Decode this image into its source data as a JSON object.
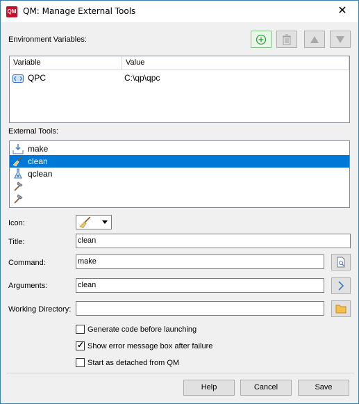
{
  "window": {
    "title": "QM: Manage External Tools",
    "close_glyph": "✕"
  },
  "env": {
    "label": "Environment Variables:",
    "columns": [
      "Variable",
      "Value"
    ],
    "rows": [
      {
        "variable": "QPC",
        "value": "C:\\qp\\qpc"
      }
    ]
  },
  "tools": {
    "label": "External Tools:",
    "items": [
      {
        "label": "make",
        "icon": "hammer-download-icon"
      },
      {
        "label": "clean",
        "icon": "broom-icon"
      },
      {
        "label": "qclean",
        "icon": "flask-icon"
      },
      {
        "label": "",
        "icon": "hammer-icon"
      },
      {
        "label": "",
        "icon": "hammer-icon"
      }
    ],
    "selected_index": 1
  },
  "form": {
    "icon_label": "Icon:",
    "title_label": "Title:",
    "title_value": "clean",
    "command_label": "Command:",
    "command_value": "make",
    "arguments_label": "Arguments:",
    "arguments_value": "clean",
    "workdir_label": "Working Directory:",
    "workdir_value": ""
  },
  "options": {
    "generate": {
      "label": "Generate code before launching",
      "checked": false
    },
    "show_error": {
      "label": "Show error message box after failure",
      "checked": true
    },
    "detached": {
      "label": "Start as detached from QM",
      "checked": false
    }
  },
  "buttons": {
    "help": "Help",
    "cancel": "Cancel",
    "save": "Save"
  }
}
